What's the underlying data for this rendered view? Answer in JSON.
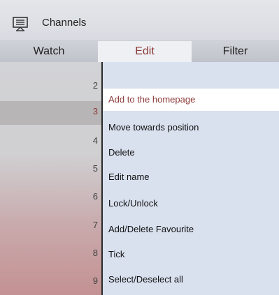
{
  "header": {
    "title": "Channels",
    "icon": "tv-list-icon"
  },
  "tabs": [
    {
      "label": "Watch"
    },
    {
      "label": "Edit"
    },
    {
      "label": "Filter"
    }
  ],
  "channels": [
    "2",
    "3",
    "4",
    "5",
    "6",
    "7",
    "8",
    "9"
  ],
  "menu": [
    "Add to the homepage",
    "Move towards position",
    "Delete",
    "Edit name",
    "Lock/Unlock",
    "Add/Delete Favourite",
    "Tick",
    "Select/Deselect all"
  ],
  "colors": {
    "accent": "#8c3a3a",
    "menu_bg": "#d9e0ee"
  }
}
